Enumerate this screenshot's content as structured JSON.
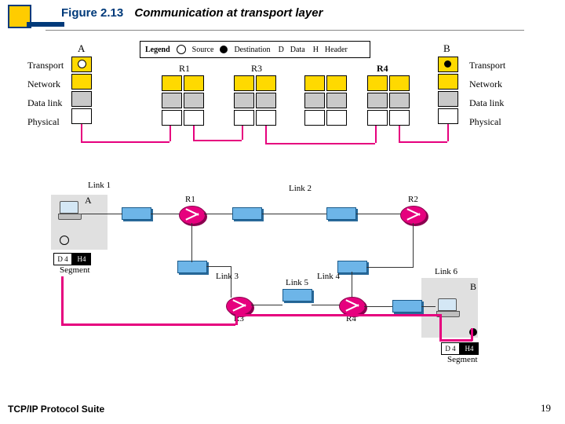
{
  "title": {
    "figure": "Figure 2.13",
    "caption": "Communication at transport layer"
  },
  "legend": {
    "label": "Legend",
    "source": "Source",
    "dest": "Destination",
    "d": "D",
    "data": "Data",
    "h": "H",
    "header": "Header"
  },
  "hosts": {
    "A": "A",
    "B": "B"
  },
  "routers": {
    "R1": "R1",
    "R2": "R2",
    "R3": "R3",
    "R4": "R4"
  },
  "layers": {
    "transport": "Transport",
    "network": "Network",
    "datalink": "Data link",
    "physical": "Physical"
  },
  "links": {
    "l1": "Link 1",
    "l2": "Link 2",
    "l3": "Link 3",
    "l4": "Link 4",
    "l5": "Link 5",
    "l6": "Link 6"
  },
  "segment": {
    "d": "D 4",
    "h": "H4",
    "label": "Segment"
  },
  "lowhosts": {
    "A": "A",
    "B": "B"
  },
  "footer": {
    "left": "TCP/IP Protocol Suite",
    "right": "19"
  }
}
